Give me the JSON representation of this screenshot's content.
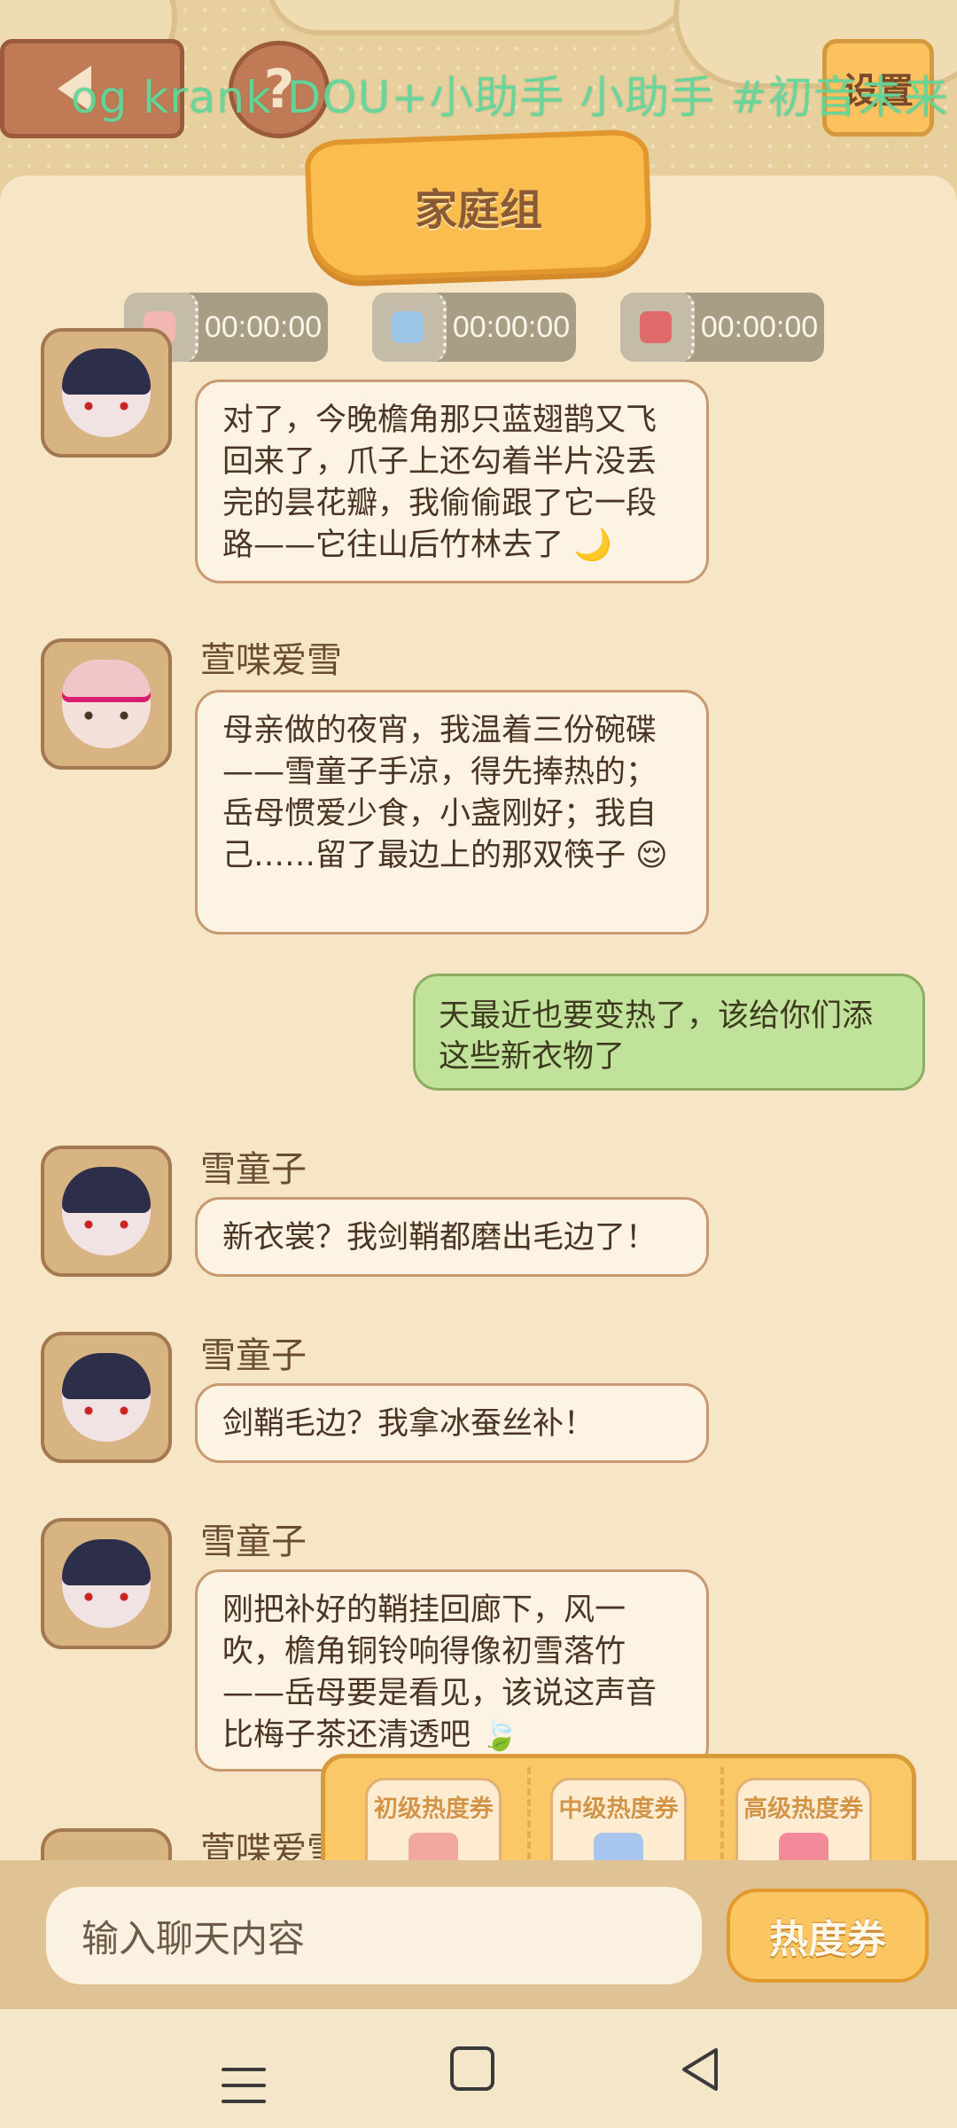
{
  "header": {
    "overlay_text": "og krank DOU+小助手 小助手 #初音未来",
    "settings_label": "设置",
    "help_label": "?",
    "group_title": "家庭组"
  },
  "timers": [
    {
      "value": "00:00:00",
      "color": "#f0b8b0"
    },
    {
      "value": "00:00:00",
      "color": "#9cc4e6"
    },
    {
      "value": "00:00:00",
      "color": "#e06a6a"
    }
  ],
  "messages": [
    {
      "sender": "",
      "text": "对了，今晚檐角那只蓝翅鹊又飞回来了，爪子上还勾着半片没丢完的昙花瓣，我偷偷跟了它一段路——它往山后竹林去了 🌙"
    },
    {
      "sender": "萱喋爱雪",
      "text": "母亲做的夜宵，我温着三份碗碟——雪童子手凉，得先捧热的；岳母惯爱少食，小盏刚好；我自己……留了最边上的那双筷子 😌"
    },
    {
      "sender": "me",
      "text": "天最近也要变热了，该给你们添这些新衣物了"
    },
    {
      "sender": "雪童子",
      "text": "新衣裳？我剑鞘都磨出毛边了！"
    },
    {
      "sender": "雪童子",
      "text": "剑鞘毛边？我拿冰蚕丝补！"
    },
    {
      "sender": "雪童子",
      "text": "刚把补好的鞘挂回廊下，风一吹，檐角铜铃响得像初雪落竹——岳母要是看见，该说这声音比梅子茶还清透吧 🍃"
    },
    {
      "sender": "萱喋爱雪",
      "text": ""
    }
  ],
  "tickets": [
    {
      "label": "初级热度券",
      "color": "#f2a7a0"
    },
    {
      "label": "中级热度券",
      "color": "#a9c6ef"
    },
    {
      "label": "高级热度券",
      "color": "#f28a9a"
    }
  ],
  "input": {
    "placeholder": "输入聊天内容",
    "heat_button": "热度券"
  }
}
